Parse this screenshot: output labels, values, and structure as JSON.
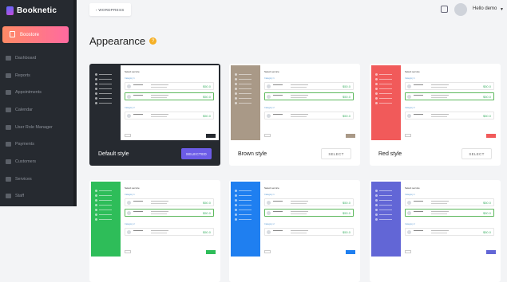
{
  "brand": {
    "name": "Booknetic"
  },
  "sidebar": {
    "boost": "Boostore",
    "items": [
      {
        "label": "Dashboard"
      },
      {
        "label": "Reports"
      },
      {
        "label": "Appointments"
      },
      {
        "label": "Calendar"
      },
      {
        "label": "User Role Manager"
      },
      {
        "label": "Payments"
      },
      {
        "label": "Customers"
      },
      {
        "label": "Services"
      },
      {
        "label": "Staff"
      }
    ]
  },
  "topbar": {
    "wordpress": "WORDPRESS",
    "greeting": "Hello demo"
  },
  "page": {
    "title": "Appearance",
    "help": "?"
  },
  "preview": {
    "title": "Select service",
    "category1": "Category 1",
    "category2": "Category 2",
    "price": "$50.0"
  },
  "styles": [
    {
      "name": "Default style",
      "button": "SELECTED",
      "color": "#262a30",
      "selected": true
    },
    {
      "name": "Brown style",
      "button": "SELECT",
      "color": "#a99987",
      "selected": false
    },
    {
      "name": "Red style",
      "button": "SELECT",
      "color": "#f15a5a",
      "selected": false
    },
    {
      "color": "#2ebd59"
    },
    {
      "color": "#1f7ff0"
    },
    {
      "color": "#6266d6"
    }
  ]
}
